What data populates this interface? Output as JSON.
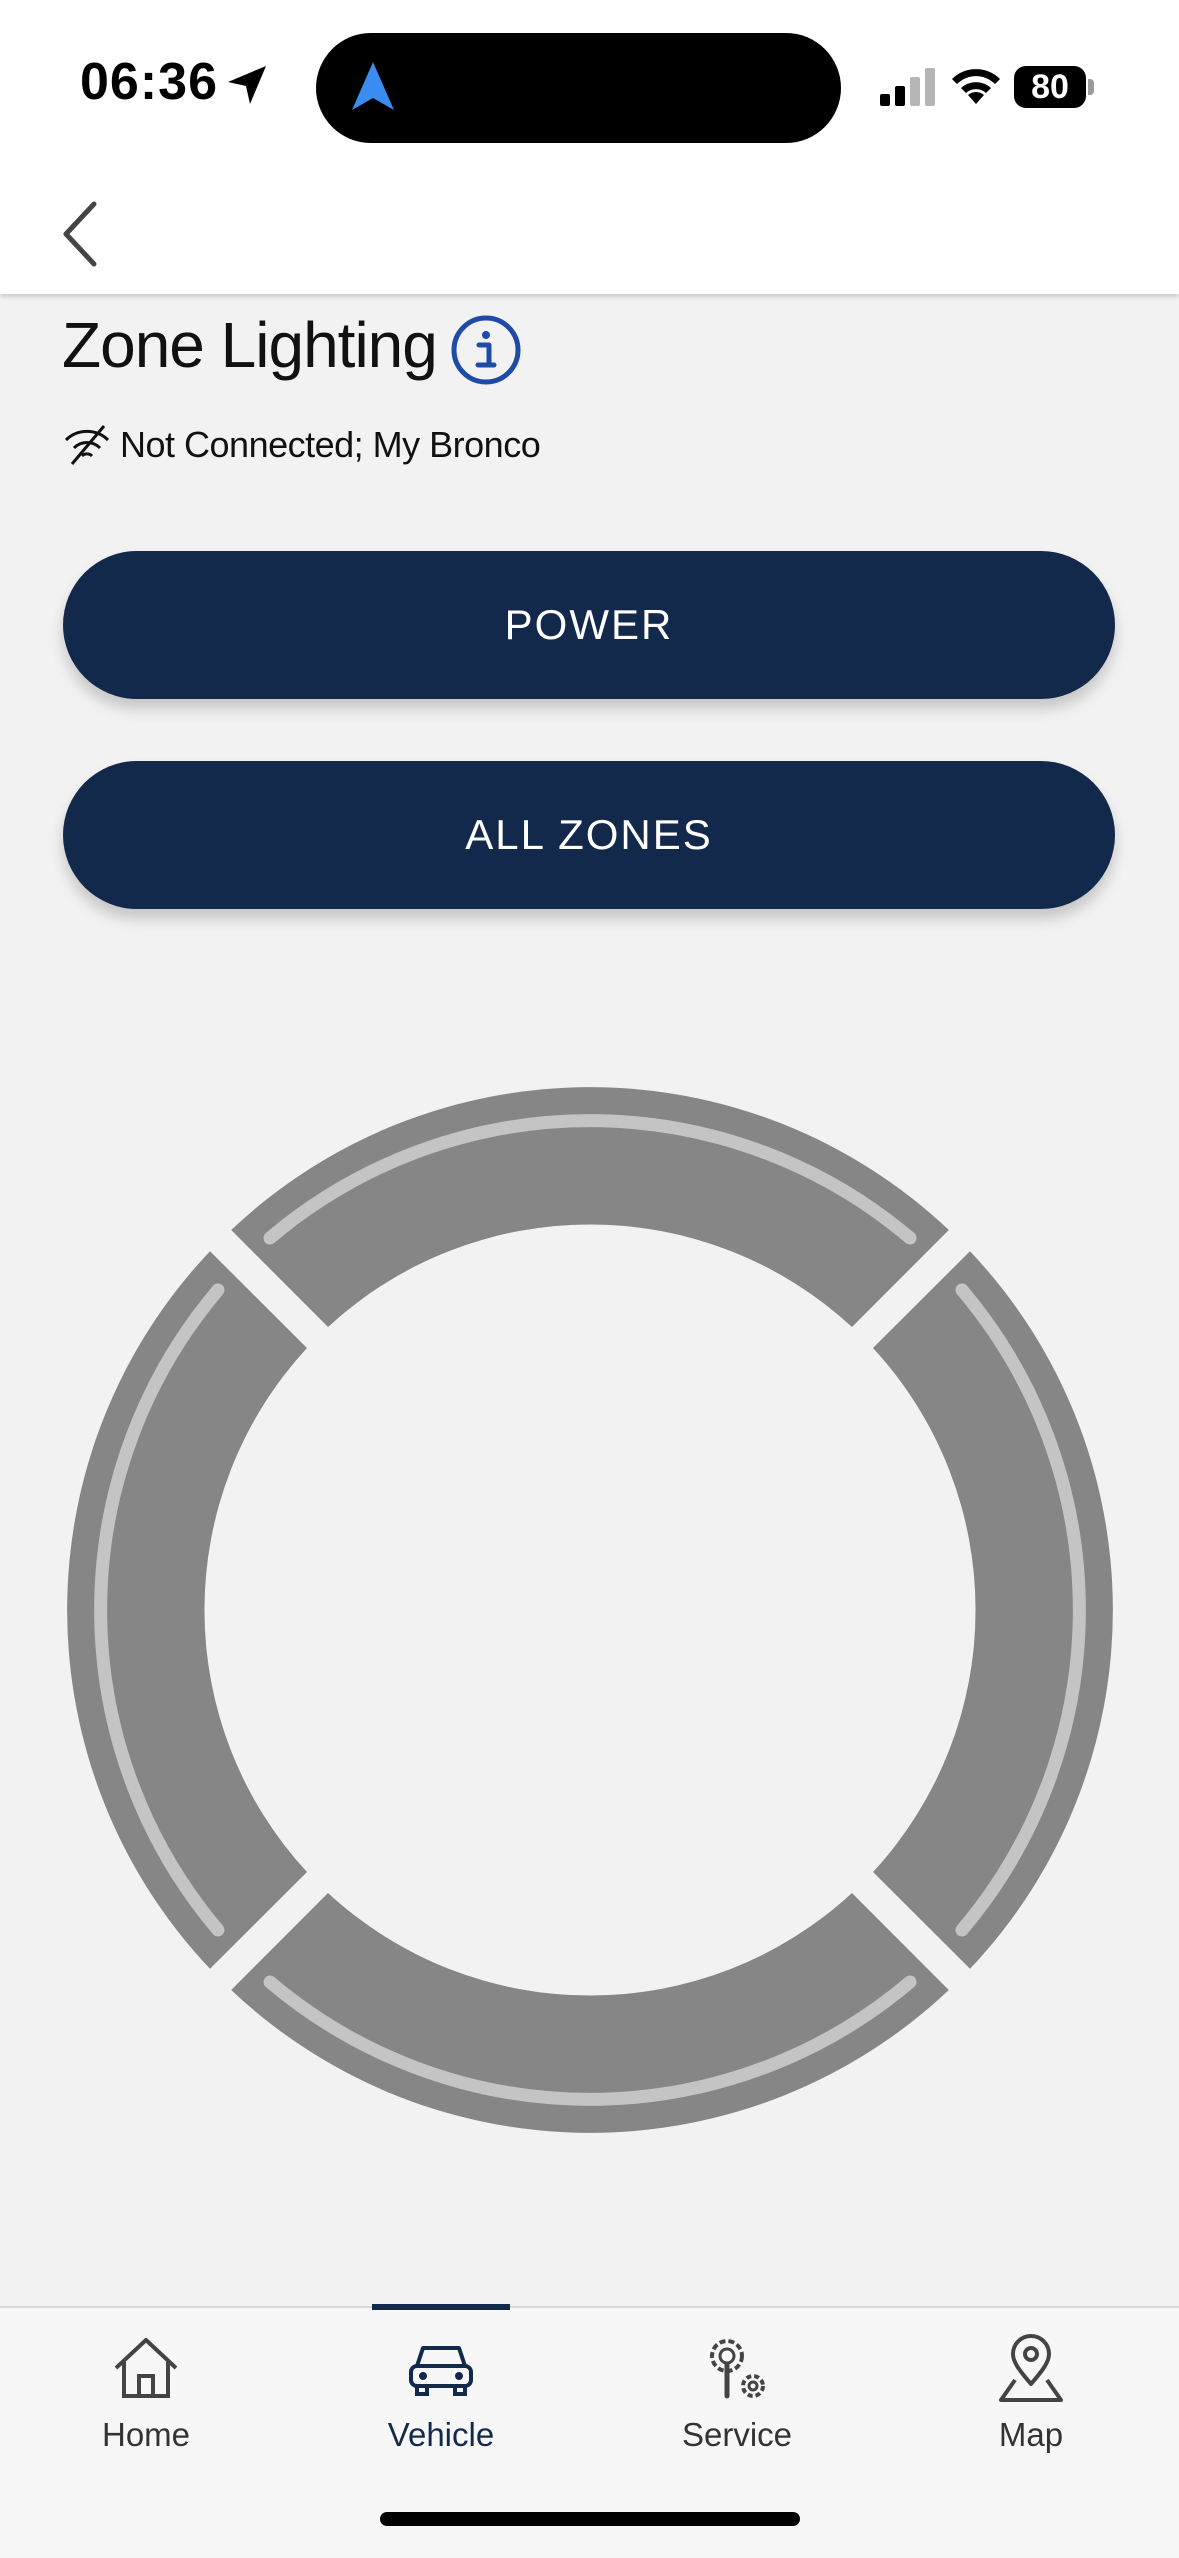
{
  "status_bar": {
    "time": "06:36",
    "battery_percent": "80",
    "signal_bars_active": 2,
    "signal_bars_total": 4
  },
  "header": {
    "back_icon": "chevron-left-icon"
  },
  "page": {
    "title": "Zone Lighting",
    "info_icon": "info-circle-icon",
    "connection_icon": "no-signal-icon",
    "connection_status": "Not Connected; My Bronco"
  },
  "buttons": {
    "power_label": "POWER",
    "all_zones_label": "ALL ZONES"
  },
  "zone_ring": {
    "zones": [
      "front",
      "right",
      "rear",
      "left"
    ],
    "zone_color": "#868686",
    "zone_highlight_color": "#c4c4c4"
  },
  "tab_bar": {
    "active_tab": "Vehicle",
    "tabs": [
      {
        "label": "Home",
        "icon": "home-icon"
      },
      {
        "label": "Vehicle",
        "icon": "car-icon"
      },
      {
        "label": "Service",
        "icon": "service-gears-icon"
      },
      {
        "label": "Map",
        "icon": "map-pin-icon"
      }
    ]
  },
  "colors": {
    "brand_navy": "#13294b",
    "info_blue": "#1e4aa8",
    "nav_arrow_blue": "#3a8cf0",
    "background": "#f2f2f2"
  }
}
